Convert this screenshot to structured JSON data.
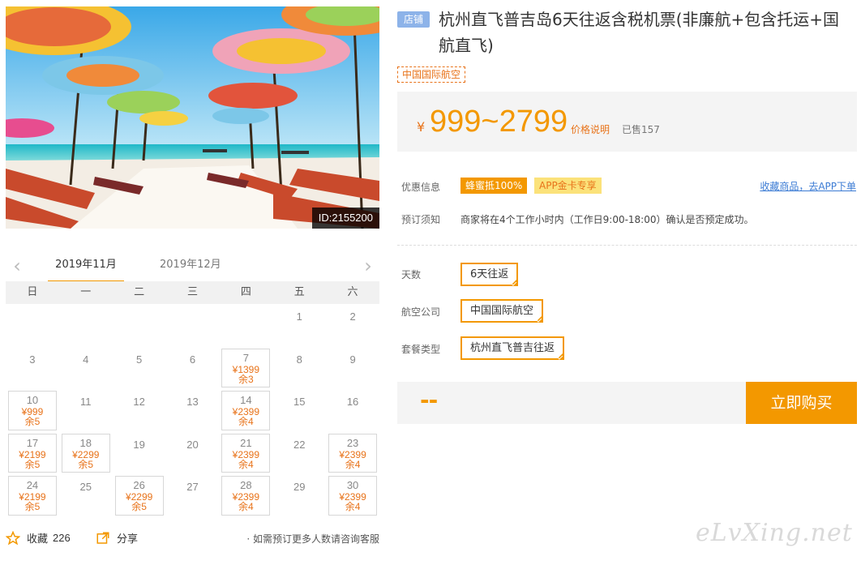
{
  "hero": {
    "id_label": "ID:2155200"
  },
  "calendar": {
    "prev_icon": "chevron-left-icon",
    "next_icon": "chevron-right-icon",
    "active_month": "2019年11月",
    "other_month": "2019年12月",
    "weekdays": [
      "日",
      "一",
      "二",
      "三",
      "四",
      "五",
      "六"
    ],
    "cells": [
      {
        "day": ""
      },
      {
        "day": ""
      },
      {
        "day": ""
      },
      {
        "day": ""
      },
      {
        "day": ""
      },
      {
        "day": "1"
      },
      {
        "day": "2"
      },
      {
        "day": "3"
      },
      {
        "day": "4"
      },
      {
        "day": "5"
      },
      {
        "day": "6"
      },
      {
        "day": "7",
        "price": "¥1399",
        "remain": "余3"
      },
      {
        "day": "8"
      },
      {
        "day": "9"
      },
      {
        "day": "10",
        "price": "¥999",
        "remain": "余5"
      },
      {
        "day": "11"
      },
      {
        "day": "12"
      },
      {
        "day": "13"
      },
      {
        "day": "14",
        "price": "¥2399",
        "remain": "余4"
      },
      {
        "day": "15"
      },
      {
        "day": "16"
      },
      {
        "day": "17",
        "price": "¥2199",
        "remain": "余5"
      },
      {
        "day": "18",
        "price": "¥2299",
        "remain": "余5"
      },
      {
        "day": "19"
      },
      {
        "day": "20"
      },
      {
        "day": "21",
        "price": "¥2399",
        "remain": "余4"
      },
      {
        "day": "22"
      },
      {
        "day": "23",
        "price": "¥2399",
        "remain": "余4"
      },
      {
        "day": "24",
        "price": "¥2199",
        "remain": "余5"
      },
      {
        "day": "25"
      },
      {
        "day": "26",
        "price": "¥2299",
        "remain": "余5"
      },
      {
        "day": "27"
      },
      {
        "day": "28",
        "price": "¥2399",
        "remain": "余4"
      },
      {
        "day": "29"
      },
      {
        "day": "30",
        "price": "¥2399",
        "remain": "余4"
      }
    ]
  },
  "footer": {
    "fav_label": "收藏",
    "fav_count": "226",
    "share_label": "分享",
    "consult": "· 如需预订更多人数请咨询客服"
  },
  "product": {
    "shop_badge": "店铺",
    "title": "杭州直飞普吉岛6天往返含税机票(非廉航+包含托运+国航直飞)",
    "airline_tag": "中国国际航空",
    "currency": "¥",
    "price_range": "999~2799",
    "price_explain": "价格说明",
    "sold": "已售157"
  },
  "info": {
    "promo_label": "优惠信息",
    "promo_bee": "蜂蜜抵100%",
    "promo_app": "APP金卡专享",
    "app_link": "收藏商品，去APP下单",
    "notice_label": "预订须知",
    "notice_text": "商家将在4个工作小时内（工作日9:00-18:00）确认是否预定成功。"
  },
  "options": {
    "days_label": "天数",
    "days_value": "6天往返",
    "airline_label": "航空公司",
    "airline_value": "中国国际航空",
    "package_label": "套餐类型",
    "package_value": "杭州直飞普吉往返"
  },
  "buy": {
    "total": "--",
    "button": "立即购买"
  },
  "watermark": "eLvXing.net",
  "colors": {
    "accent": "#f39800",
    "price": "#e8731a",
    "link": "#3b7bd4"
  }
}
